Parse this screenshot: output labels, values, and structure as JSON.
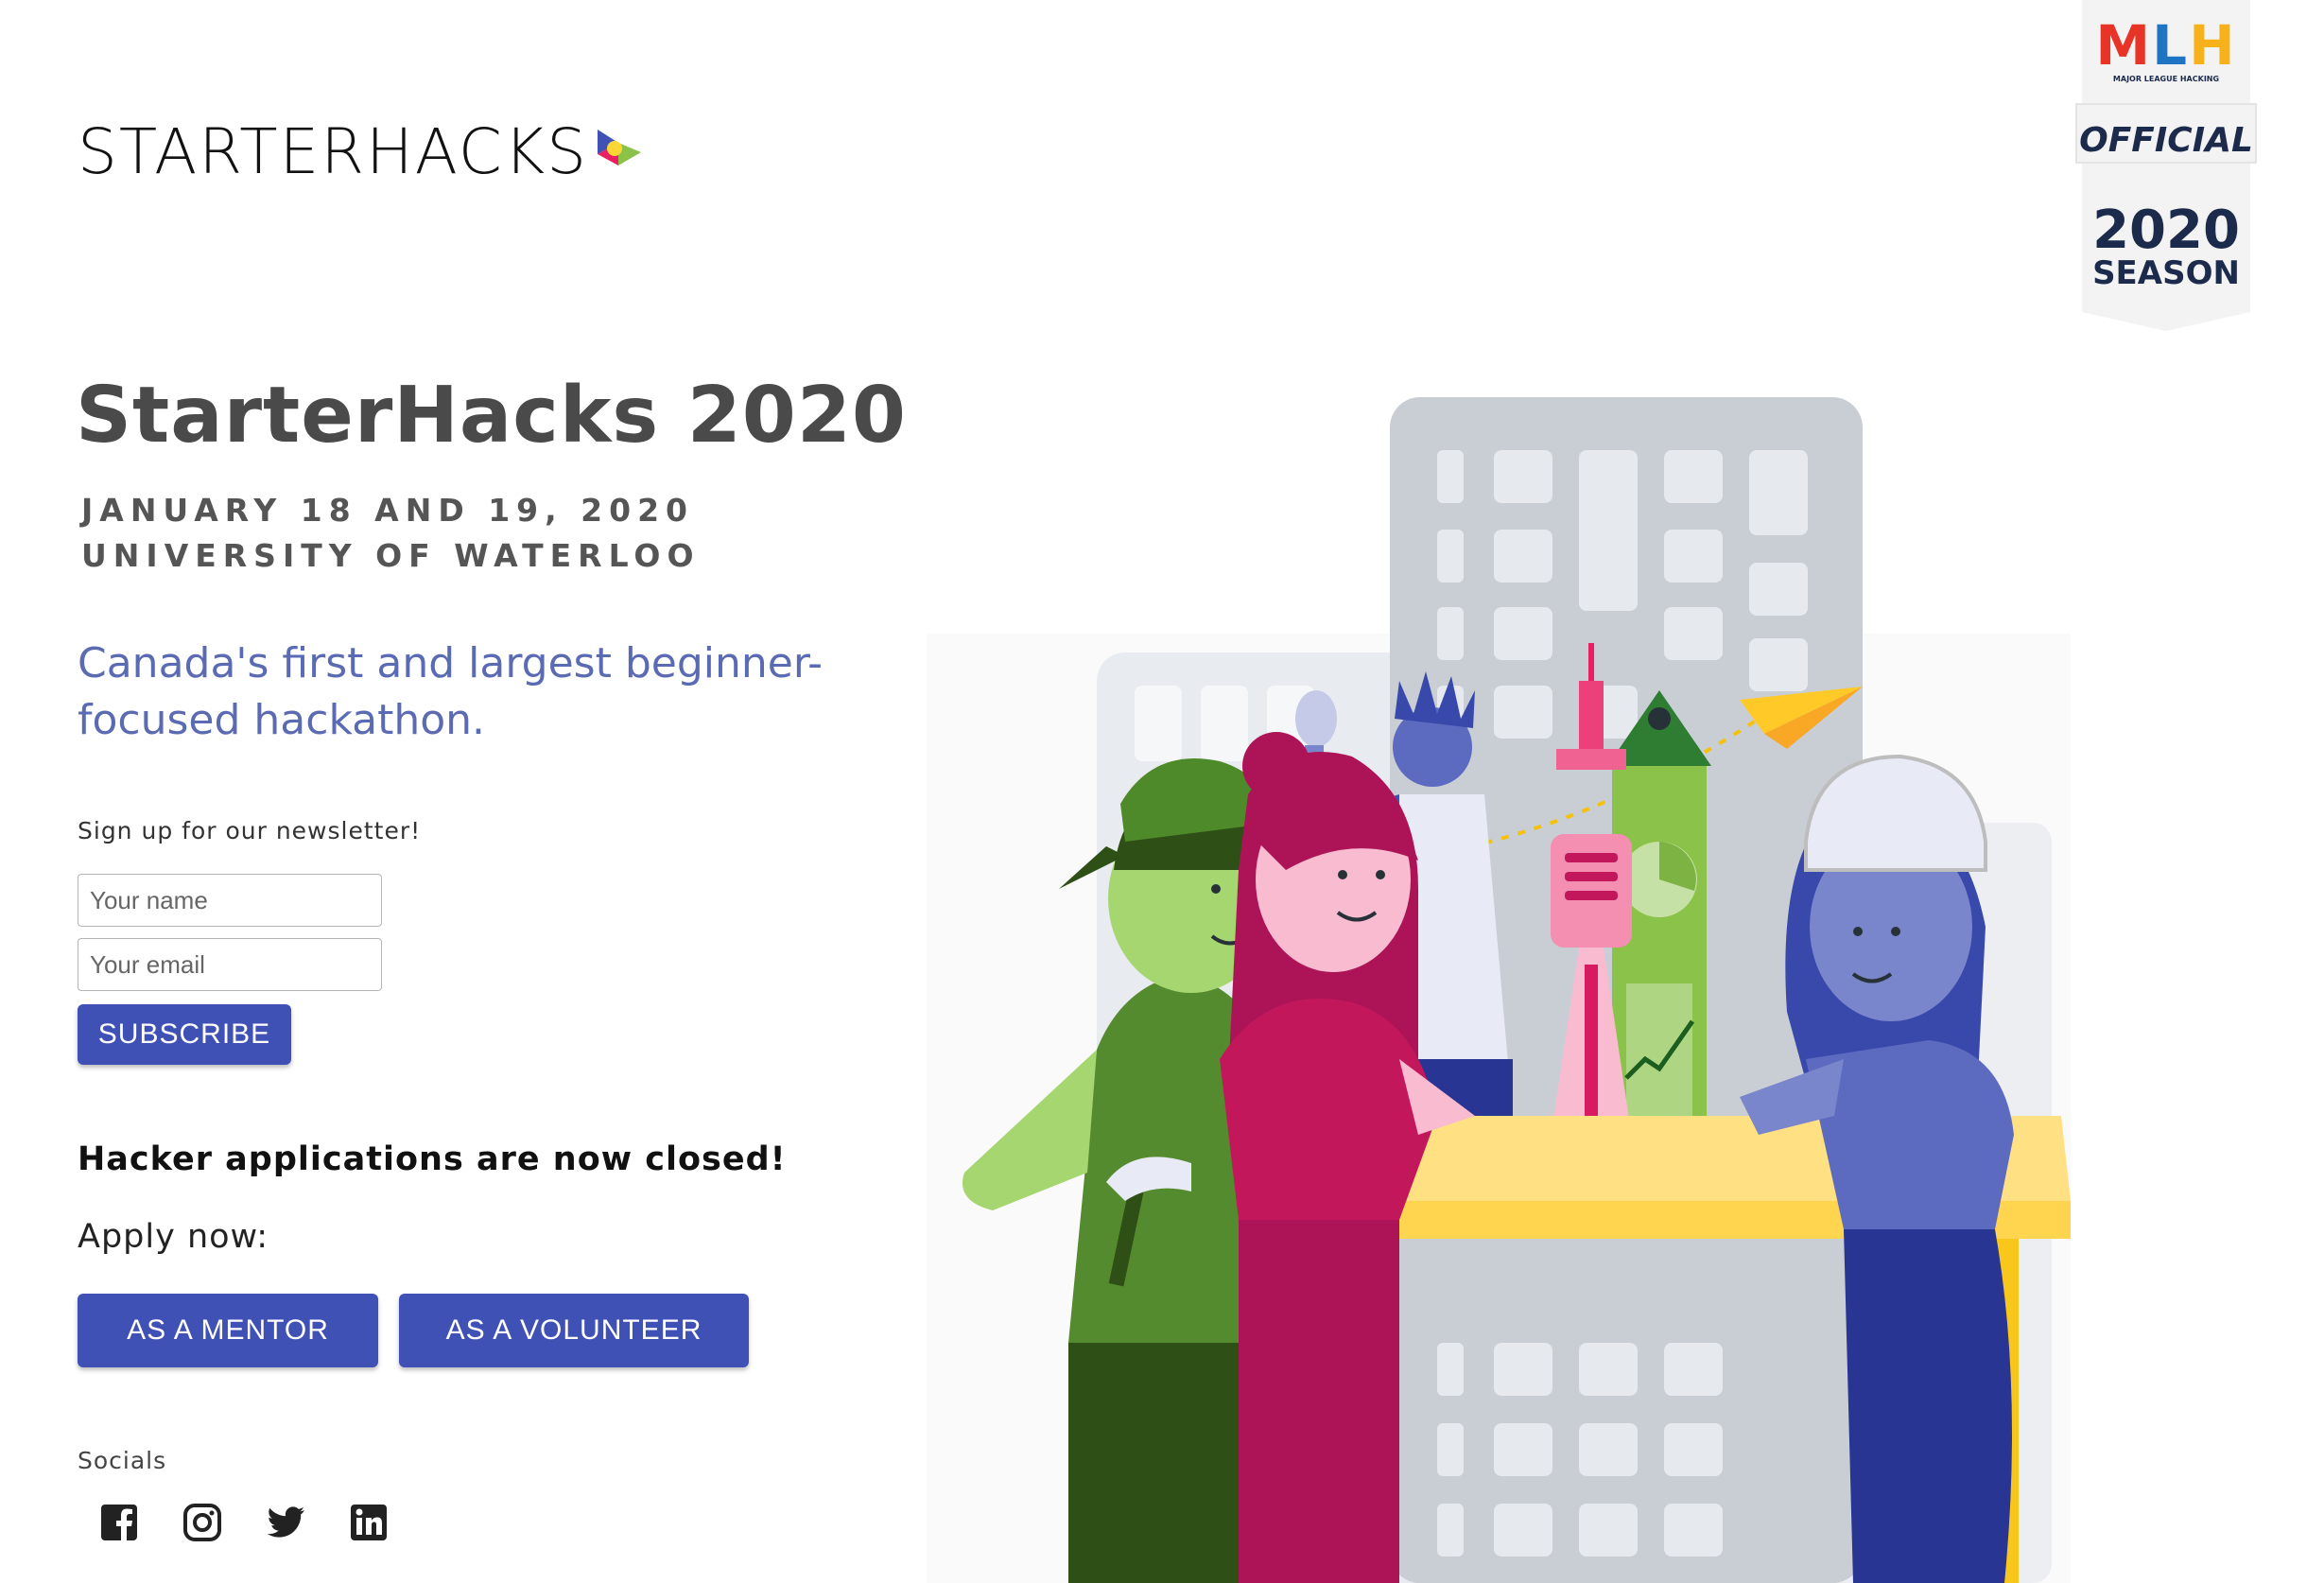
{
  "brand": {
    "logo_text": "STARTERHACKS"
  },
  "mlh_badge": {
    "top": "MLH",
    "small": "MAJOR LEAGUE HACKING",
    "official": "OFFICIAL",
    "year": "2020",
    "season": "SEASON"
  },
  "hero": {
    "title": "StarterHacks 2020",
    "date": "JANUARY 18 AND 19, 2020",
    "location": "UNIVERSITY OF WATERLOO",
    "tagline_line1": "Canada's first and largest beginner-",
    "tagline_line2": "focused hackathon."
  },
  "newsletter": {
    "label": "Sign up for our newsletter!",
    "name_placeholder": "Your name",
    "email_placeholder": "Your email",
    "subscribe_label": "SUBSCRIBE"
  },
  "applications": {
    "closed_text": "Hacker applications are now closed!",
    "apply_label": "Apply now:",
    "mentor_label": "AS A MENTOR",
    "volunteer_label": "AS A VOLUNTEER"
  },
  "socials": {
    "label": "Socials",
    "icons": [
      "facebook-icon",
      "instagram-icon",
      "twitter-icon",
      "linkedin-icon"
    ]
  },
  "colors": {
    "primary": "#3f51b5",
    "tagline": "#5a6bb3",
    "title": "#4a4a4a"
  }
}
